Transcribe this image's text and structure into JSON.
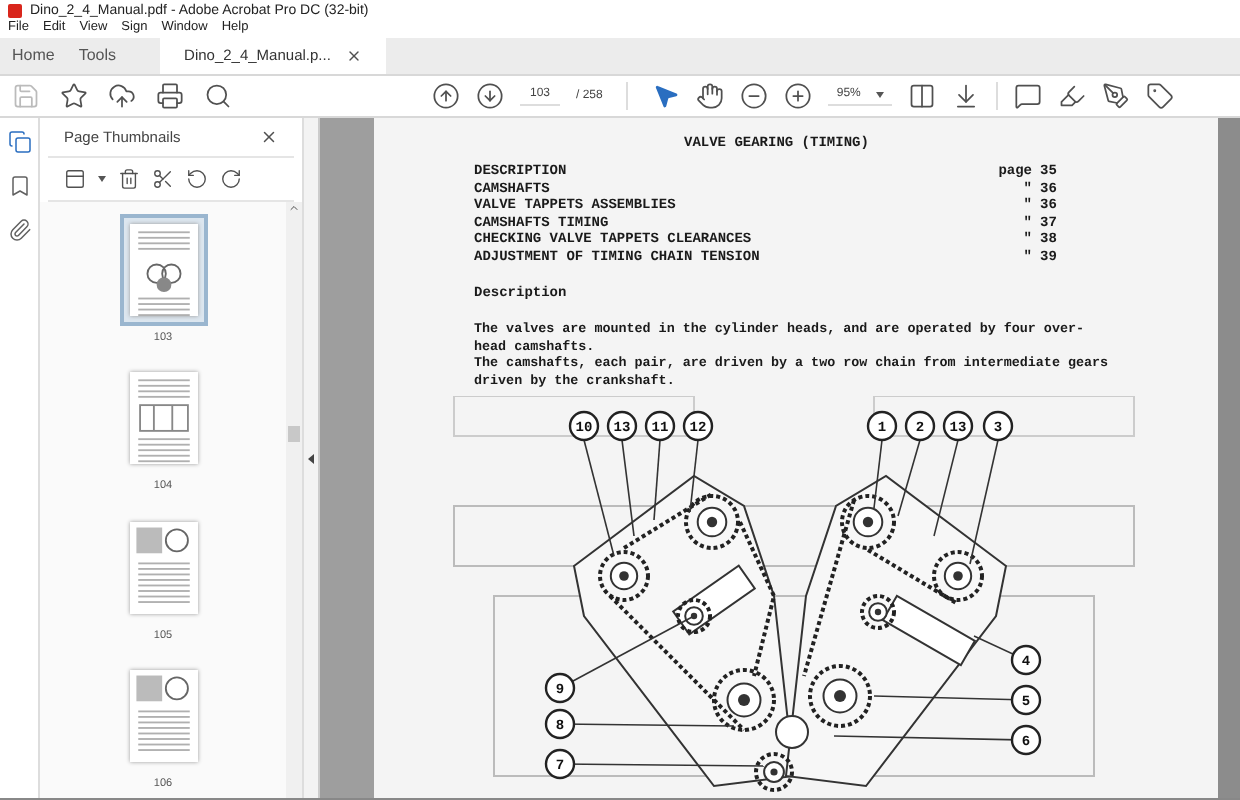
{
  "window": {
    "title": "Dino_2_4_Manual.pdf - Adobe Acrobat Pro DC (32-bit)"
  },
  "menu": [
    "File",
    "Edit",
    "View",
    "Sign",
    "Window",
    "Help"
  ],
  "tabs": [
    {
      "label": "Home",
      "selected": false
    },
    {
      "label": "Tools",
      "selected": false
    },
    {
      "label": "Dino_2_4_Manual.p...",
      "selected": true,
      "closable": true
    }
  ],
  "toolbar": {
    "save": {
      "disabled": true
    },
    "page": "103",
    "page_total": "/ 258",
    "zoom": "95%",
    "tools": [
      {
        "kind": "pointer",
        "selected": true
      },
      {
        "kind": "hand",
        "selected": false
      }
    ]
  },
  "side_rail": [
    {
      "kind": "pages",
      "selected": true
    },
    {
      "kind": "bookmarks",
      "selected": false
    },
    {
      "kind": "attachments",
      "selected": false
    }
  ],
  "thumbnail_panel": {
    "title": "Page Thumbnails",
    "thumbnails": [
      {
        "label": "103",
        "selected": true,
        "kind": "diagram"
      },
      {
        "label": "104",
        "selected": false,
        "kind": "table"
      },
      {
        "label": "105",
        "selected": false,
        "kind": "figures"
      },
      {
        "label": "106",
        "selected": false,
        "kind": "figures"
      }
    ]
  },
  "document": {
    "heading": "VALVE GEARING (TIMING)",
    "contents": [
      {
        "title": "DESCRIPTION",
        "ref": "page",
        "page": "35"
      },
      {
        "title": "CAMSHAFTS",
        "ref": "\"",
        "page": "36"
      },
      {
        "title": "VALVE TAPPETS ASSEMBLIES",
        "ref": "\"",
        "page": "36"
      },
      {
        "title": "CAMSHAFTS TIMING",
        "ref": "\"",
        "page": "37"
      },
      {
        "title": "CHECKING VALVE TAPPETS CLEARANCES",
        "ref": "\"",
        "page": "38"
      },
      {
        "title": "ADJUSTMENT OF TIMING CHAIN TENSION",
        "ref": "\"",
        "page": "39"
      }
    ],
    "section": "Description",
    "paragraphs": [
      "The valves are mounted in the cylinder heads, and are operated by four over-\nhead camshafts.",
      "The camshafts, each pair, are driven by a two row chain from intermediate gears\ndriven by the crankshaft."
    ],
    "callouts": [
      "10",
      "13",
      "11",
      "12",
      "1",
      "2",
      "13",
      "3",
      "4",
      "5",
      "6",
      "9",
      "8",
      "7"
    ]
  }
}
